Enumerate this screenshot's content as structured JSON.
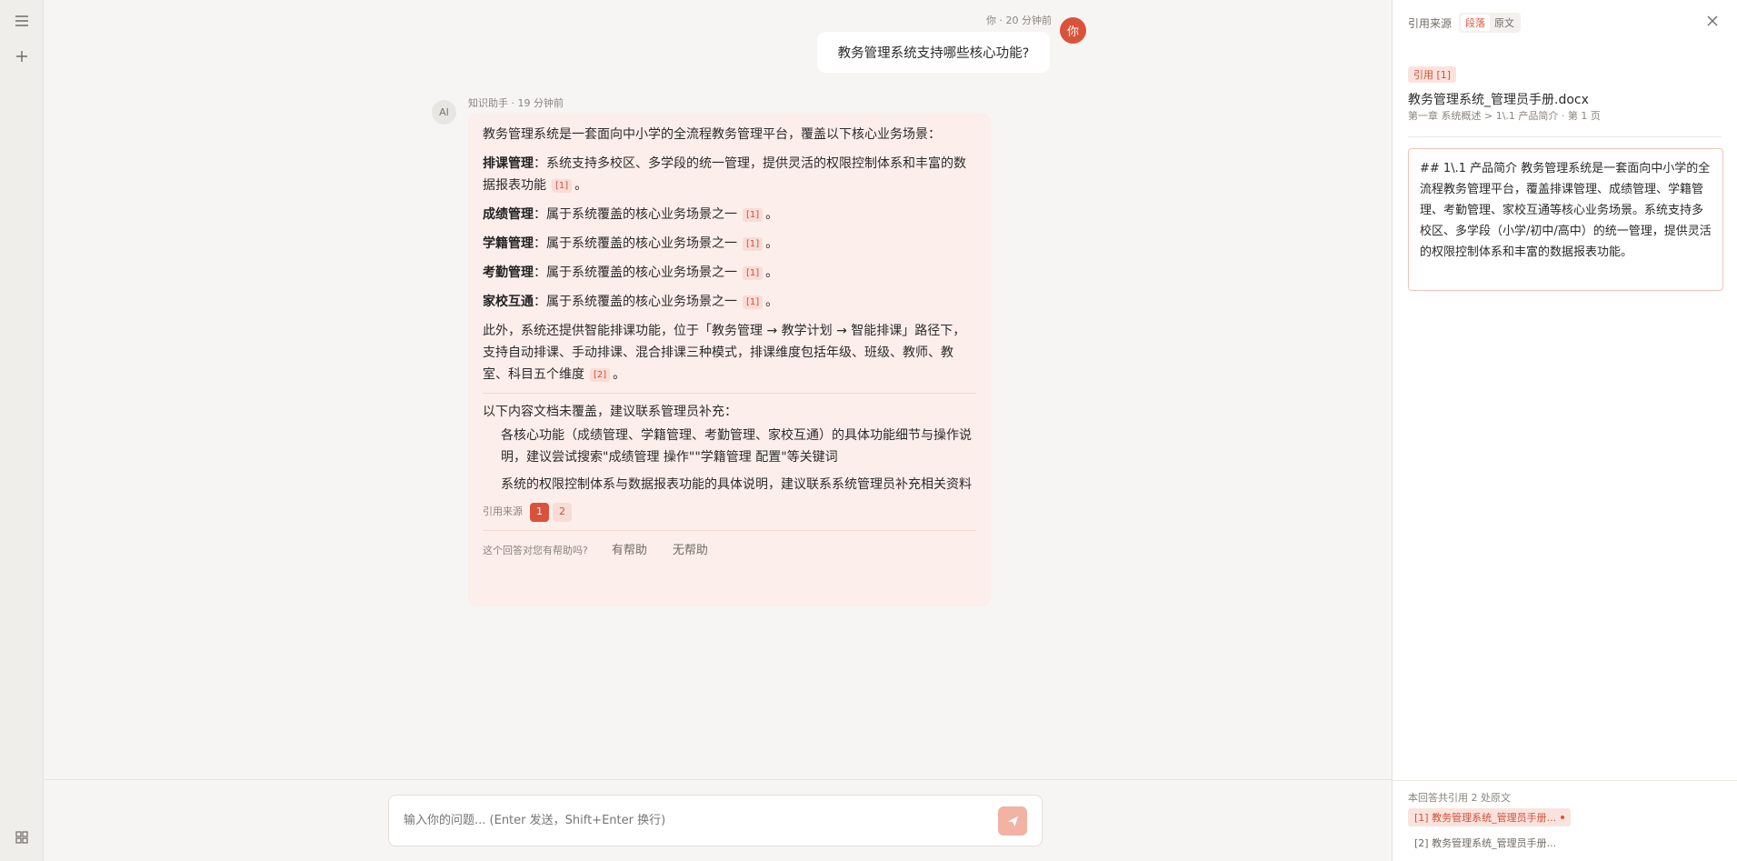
{
  "rail": {
    "menu_icon": "menu-icon",
    "new_icon": "plus-icon",
    "apps_icon": "grid-icon"
  },
  "user_message": {
    "meta": "你 · 20 分钟前",
    "avatar": "你",
    "text": "教务管理系统支持哪些核心功能?"
  },
  "ai_message": {
    "avatar": "AI",
    "meta": "知识助手 · 19 分钟前",
    "intro": "教务管理系统是一套面向中小学的全流程教务管理平台，覆盖以下核心业务场景：",
    "items": [
      {
        "title": "排课管理",
        "text": "：系统支持多校区、多学段的统一管理，提供灵活的权限控制体系和丰富的数据报表功能",
        "cite": "[1]",
        "end": "。"
      },
      {
        "title": "成绩管理",
        "text": "：属于系统覆盖的核心业务场景之一",
        "cite": "[1]",
        "end": "。"
      },
      {
        "title": "学籍管理",
        "text": "：属于系统覆盖的核心业务场景之一",
        "cite": "[1]",
        "end": "。"
      },
      {
        "title": "考勤管理",
        "text": "：属于系统覆盖的核心业务场景之一",
        "cite": "[1]",
        "end": "。"
      },
      {
        "title": "家校互通",
        "text": "：属于系统覆盖的核心业务场景之一",
        "cite": "[1]",
        "end": "。"
      }
    ],
    "extra": "此外，系统还提供智能排课功能，位于「教务管理 → 教学计划 → 智能排课」路径下，支持自动排课、手动排课、混合排课三种模式，排课维度包括年级、班级、教师、教室、科目五个维度",
    "extra_cite": "[2]",
    "extra_end": "。",
    "uncovered_title": "以下内容文档未覆盖，建议联系管理员补充：",
    "uncovered": [
      "各核心功能（成绩管理、学籍管理、考勤管理、家校互通）的具体功能细节与操作说明，建议尝试搜索\"成绩管理 操作\"\"学籍管理 配置\"等关键词",
      "系统的权限控制体系与数据报表功能的具体说明，建议联系系统管理员补充相关资料"
    ],
    "sources_label": "引用来源",
    "sources": [
      "1",
      "2"
    ],
    "feedback_q": "这个回答对您有帮助吗?",
    "helpful": "有帮助",
    "unhelpful": "无帮助"
  },
  "input": {
    "placeholder": "输入你的问题... (Enter 发送，Shift+Enter 换行)",
    "send_icon": "send-icon"
  },
  "panel": {
    "title": "引用来源",
    "tabs": [
      "段落",
      "原文"
    ],
    "active_tab": "段落",
    "ref_badge": "引用 [1]",
    "doc_title": "教务管理系统_管理员手册.docx",
    "doc_path": "第一章 系统概述 > 1\\.1 产品简介 · 第 1 页",
    "excerpt": "## 1\\.1 产品简介 教务管理系统是一套面向中小学的全流程教务管理平台，覆盖排课管理、成绩管理、学籍管理、考勤管理、家校互通等核心业务场景。系统支持多校区、多学段（小学/初中/高中）的统一管理，提供灵活的权限控制体系和丰富的数据报表功能。",
    "footer_title": "本回答共引用 2 处原文",
    "footer_items": [
      "[1] 教务管理系统_管理员手册...",
      "[2] 教务管理系统_管理员手册..."
    ]
  },
  "colors": {
    "accent": "#d9533a",
    "bubble": "#fceeeb",
    "bg": "#f6f5f3"
  }
}
